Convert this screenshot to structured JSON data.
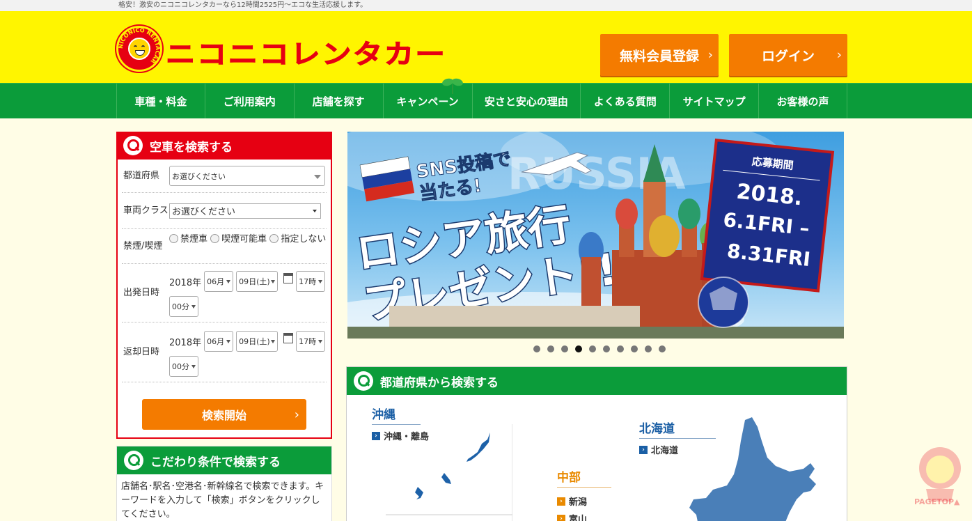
{
  "topbar": {
    "text": "格安！激安のニコニコレンタカーなら12時間2525円〜エコな生活応援します。"
  },
  "header": {
    "logo_text": "ニコニコレンタカー",
    "logo_ring_text": "NICONICO RENTACAR",
    "register_button": "無料会員登録",
    "login_button": "ログイン"
  },
  "nav": {
    "items": [
      "車種・料金",
      "ご利用案内",
      "店舗を探す",
      "キャンペーン",
      "安さと安心の理由",
      "よくある質問",
      "サイトマップ",
      "お客様の声"
    ]
  },
  "search_form": {
    "title": "空車を検索する",
    "prefecture_label": "都道府県",
    "prefecture_value": "お選びください",
    "class_label": "車両クラス",
    "class_value": "お選びください",
    "smoking_label": "禁煙/喫煙",
    "smoking_options": [
      "禁煙車",
      "喫煙可能車",
      "指定しない"
    ],
    "depart_label": "出発日時",
    "depart": {
      "year": "2018年",
      "month": "06月",
      "day": "09日(土)",
      "hour": "17時",
      "minute": "00分"
    },
    "return_label": "返却日時",
    "return": {
      "year": "2018年",
      "month": "06月",
      "day": "09日(土)",
      "hour": "17時",
      "minute": "00分"
    },
    "submit": "検索開始"
  },
  "keyword_box": {
    "title": "こだわり条件で検索する",
    "description": "店舗名･駅名･空港名･新幹線名で検索できます。キーワードを入力して「検索」ボタンをクリックしてください。"
  },
  "banner": {
    "headline_1": "SNS投稿で",
    "headline_2": "当たる!",
    "main_1": "ロシア旅行",
    "main_2": "プレゼント!!",
    "backdrop": "RUSSIA",
    "period_label": "応募期間",
    "period_year": "2018.",
    "period_start": "6.1FRI –",
    "period_end": "8.31FRI"
  },
  "carousel": {
    "count": 10,
    "active_index": 3
  },
  "prefecture_search": {
    "title": "都道府県から検索する",
    "regions": [
      {
        "name": "沖縄",
        "links": [
          "沖縄・離島"
        ]
      },
      {
        "name": "北海道",
        "links": [
          "北海道"
        ]
      },
      {
        "name": "中部",
        "links": [
          "新潟",
          "富山"
        ]
      }
    ]
  },
  "pagetop": {
    "label": "PAGETOP▲"
  },
  "colors": {
    "brand_red": "#e60012",
    "brand_yellow": "#fff500",
    "nav_green": "#0b9c3a",
    "button_orange": "#f47b00",
    "region_blue": "#1b5fa5",
    "region_orange": "#e98a00"
  }
}
